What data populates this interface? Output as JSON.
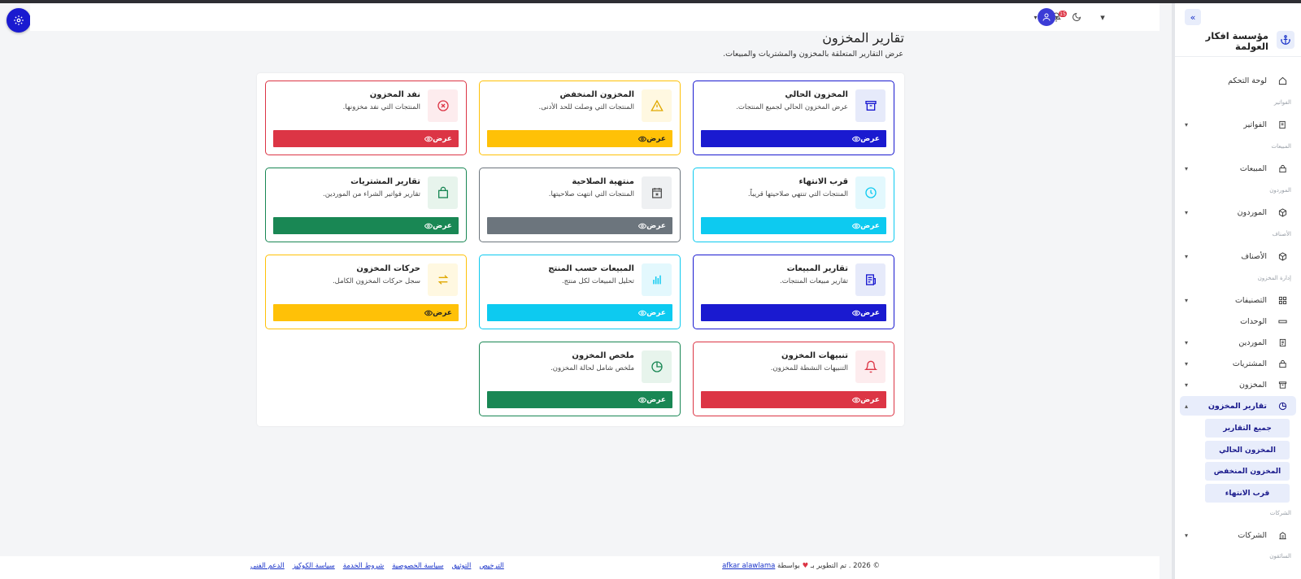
{
  "colors": {
    "primary": "#1a1ad0",
    "warning": "#ffc107",
    "danger": "#dc3545",
    "success": "#198754",
    "secondary": "#6c757d",
    "info": "#0dcaf0"
  },
  "sidebar": {
    "brand_name": "مؤسسة افكار العولمة",
    "brand_icon": "anchor-icon",
    "collapse_icon": "double-chevron-right-icon",
    "dashboard": "لوحة التحكم",
    "sections": {
      "invoices": "الفواتير",
      "sales": "المبيعات",
      "suppliers": "الموردون",
      "items": "الأصناف",
      "inventory_mgmt": "إدارة المخزون",
      "companies": "الشركات",
      "drivers": "السائقون"
    },
    "items": {
      "invoices": "الفواتير",
      "sales": "المبيعات",
      "suppliers": "الموردون",
      "items": "الأصناف",
      "categories": "التصنيفات",
      "units": "الوحدات",
      "suppliers2": "الموردين",
      "purchases": "المشتريات",
      "inventory": "المخزون",
      "inventory_reports": "تقارير المخزون",
      "companies": "الشركات"
    },
    "sub_items": [
      "جميع التقارير",
      "المخزون الحالي",
      "المخزون المنخفض",
      "قرب الانتهاء"
    ]
  },
  "header": {
    "notification_count": "15"
  },
  "page": {
    "title": "تقارير المخزون",
    "subtitle": "عرض التقارير المتعلقة بالمخزون والمشتريات والمبيعات."
  },
  "cards": [
    {
      "title": "المخزون الحالي",
      "desc": "عرض المخزون الحالي لجميع المنتجات.",
      "btn": "عرض",
      "color": "#1a1ad0",
      "icon": "archive-icon"
    },
    {
      "title": "المخزون المنخفض",
      "desc": "المنتجات التي وصلت للحد الأدنى.",
      "btn": "عرض",
      "color": "#ffc107",
      "icon": "warning-icon"
    },
    {
      "title": "نفد المخزون",
      "desc": "المنتجات التي نفد مخزونها.",
      "btn": "عرض",
      "color": "#dc3545",
      "icon": "x-circle-icon"
    },
    {
      "title": "قرب الانتهاء",
      "desc": "المنتجات التي تنتهي صلاحيتها قريباً.",
      "btn": "عرض",
      "color": "#0dcaf0",
      "icon": "clock-icon"
    },
    {
      "title": "منتهية الصلاحية",
      "desc": "المنتجات التي انتهت صلاحيتها.",
      "btn": "عرض",
      "color": "#6c757d",
      "icon": "calendar-x-icon"
    },
    {
      "title": "تقارير المشتريات",
      "desc": "تقارير فواتير الشراء من الموردين.",
      "btn": "عرض",
      "color": "#198754",
      "icon": "bag-icon"
    },
    {
      "title": "تقارير المبيعات",
      "desc": "تقارير مبيعات المنتجات.",
      "btn": "عرض",
      "color": "#1a1ad0",
      "icon": "receipt-icon"
    },
    {
      "title": "المبيعات حسب المنتج",
      "desc": "تحليل المبيعات لكل منتج.",
      "btn": "عرض",
      "color": "#0dcaf0",
      "icon": "bar-chart-icon"
    },
    {
      "title": "حركات المخزون",
      "desc": "سجل حركات المخزون الكامل.",
      "btn": "عرض",
      "color": "#ffc107",
      "icon": "arrows-exchange-icon"
    },
    {
      "title": "تنبيهات المخزون",
      "desc": "التنبيهات النشطة للمخزون.",
      "btn": "عرض",
      "color": "#dc3545",
      "icon": "bell-icon"
    },
    {
      "title": "ملخص المخزون",
      "desc": "ملخص شامل لحالة المخزون.",
      "btn": "عرض",
      "color": "#198754",
      "icon": "pie-chart-icon"
    }
  ],
  "footer": {
    "copyright": "© 2026 . تم التطوير بـ",
    "by": "بواسطة",
    "author": "afkar alawlama",
    "links": [
      "الترخيص",
      "التوثيق",
      "سياسة الخصوصية",
      "شروط الخدمة",
      "سياسة الكوكيز",
      "الدعم الفني"
    ]
  }
}
